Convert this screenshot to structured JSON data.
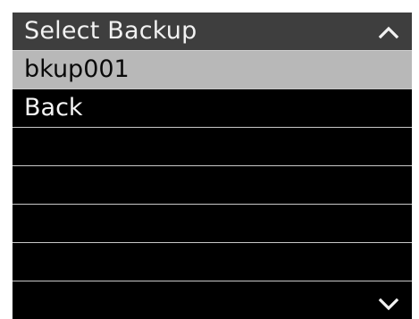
{
  "header": {
    "title": "Select Backup",
    "scroll_up_icon": "chevron-up-icon"
  },
  "list": {
    "items": [
      {
        "label": "bkup001",
        "selected": true
      },
      {
        "label": "Back",
        "selected": false
      },
      {
        "label": "",
        "selected": false
      },
      {
        "label": "",
        "selected": false
      },
      {
        "label": "",
        "selected": false
      },
      {
        "label": "",
        "selected": false
      },
      {
        "label": "",
        "selected": false
      }
    ]
  },
  "footer": {
    "scroll_down_icon": "chevron-down-icon"
  },
  "colors": {
    "background": "#000000",
    "header": "#3e3e3e",
    "selected_row": "#b8b8b8",
    "divider": "#c8c8c8",
    "text_light": "#f5f5f5",
    "text_dark": "#0a0a0a"
  }
}
